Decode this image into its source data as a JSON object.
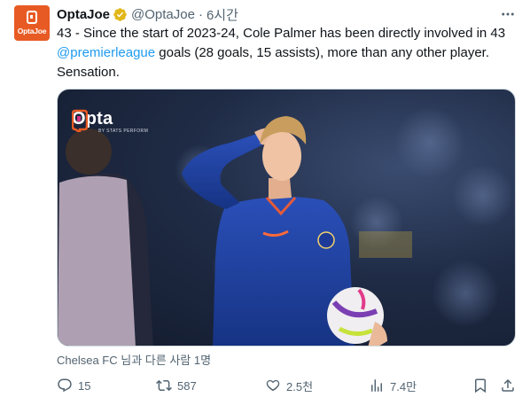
{
  "tweet": {
    "author_name": "OptaJoe",
    "author_handle": "@OptaJoe",
    "separator": "·",
    "time": "6시간",
    "avatar_text": "OptaJoe",
    "text_before": "43 - Since the start of 2023-24, Cole Palmer has been directly involved in 43 ",
    "mention": "@premierleague",
    "text_after": " goals (28 goals, 15 assists), more than any other player. Sensation.",
    "tagged": "Chelsea FC 님과 다른 사람 1명"
  },
  "media": {
    "logo_word": "Opta",
    "logo_sub": "BY STATS PERFORM"
  },
  "actions": {
    "replies": "15",
    "reposts": "587",
    "likes": "2.5천",
    "views": "7.4만"
  },
  "icons": [
    "more-icon",
    "verified-badge-icon",
    "reply-icon",
    "repost-icon",
    "like-icon",
    "views-icon",
    "bookmark-icon",
    "share-icon"
  ],
  "colors": {
    "accent": "#1d9bf0",
    "muted": "#536471",
    "brand_orange": "#e85a24",
    "verified_gold": "#e2b719"
  }
}
